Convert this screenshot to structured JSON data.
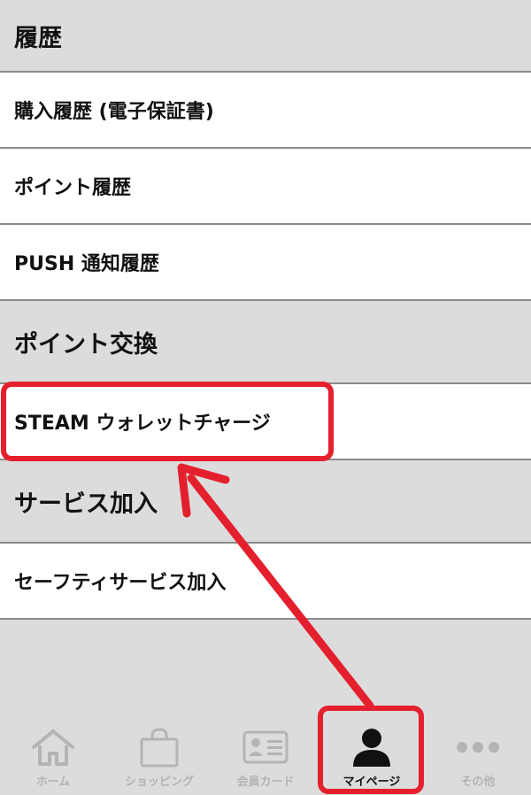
{
  "sections": [
    {
      "header": "履歴",
      "items": [
        "購入履歴 (電子保証書)",
        "ポイント履歴",
        "PUSH 通知履歴"
      ]
    },
    {
      "header": "ポイント交換",
      "items": [
        "STEAM ウォレットチャージ"
      ]
    },
    {
      "header": "サービス加入",
      "items": [
        "セーフティサービス加入"
      ]
    }
  ],
  "tabbar": {
    "tabs": [
      {
        "label": "ホーム",
        "icon": "home-icon"
      },
      {
        "label": "ショッピング",
        "icon": "shopping-bag-icon"
      },
      {
        "label": "会員カード",
        "icon": "member-card-icon"
      },
      {
        "label": "マイページ",
        "icon": "person-icon",
        "active": true
      },
      {
        "label": "その他",
        "icon": "more-dots-icon"
      }
    ]
  },
  "colors": {
    "annotation_red": "#e5202e",
    "background_gray": "#dcdcdc",
    "inactive_gray": "#b4b4b4"
  }
}
